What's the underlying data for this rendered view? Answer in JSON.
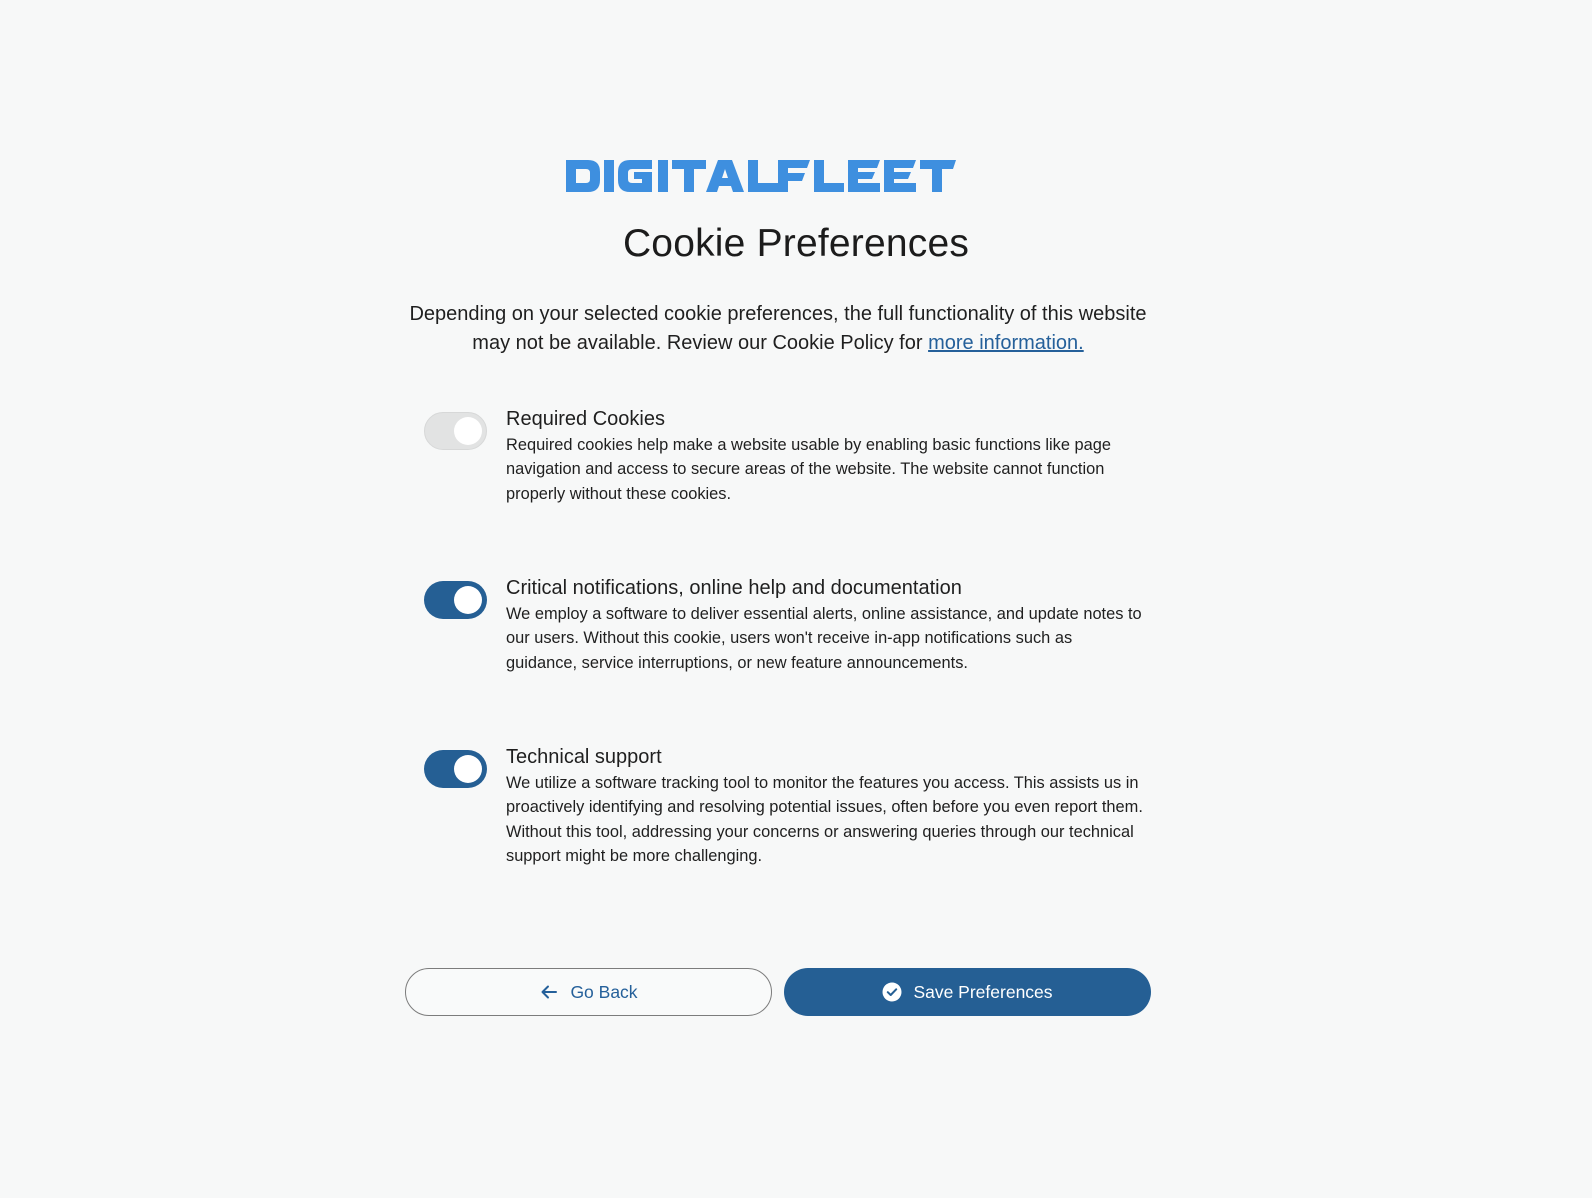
{
  "brand": {
    "logo_text": "DIGITALFLEET",
    "color": "#3e8fdf"
  },
  "page": {
    "title": "Cookie Preferences",
    "intro_text": "Depending on your selected cookie preferences, the full functionality of this website may not be available. Review our Cookie Policy for ",
    "intro_link_text": "more information."
  },
  "preferences": [
    {
      "name": "Required Cookies",
      "description": "Required cookies help make a website usable by enabling basic functions like page navigation and access to secure areas of the website. The website cannot function properly without these cookies.",
      "enabled": true,
      "locked": true
    },
    {
      "name": "Critical notifications, online help and documentation",
      "description": "We employ a software to deliver essential alerts, online assistance, and update notes to our users. Without this cookie, users won't receive in-app notifications such as guidance, service interruptions, or new feature announcements.",
      "enabled": true,
      "locked": false
    },
    {
      "name": "Technical support",
      "description": "We utilize a software tracking tool to monitor the features you access. This assists us in proactively identifying and resolving potential issues, often before you even report them. Without this tool, addressing your concerns or answering queries through our technical support might be more challenging.",
      "enabled": true,
      "locked": false
    }
  ],
  "actions": {
    "back_label": "Go Back",
    "back_icon": "arrow-left-icon",
    "save_label": "Save Preferences",
    "save_icon": "check-circle-icon"
  },
  "colors": {
    "accent": "#255f94",
    "background": "#f7f8f8",
    "toggle_disabled": "#e2e3e3"
  }
}
